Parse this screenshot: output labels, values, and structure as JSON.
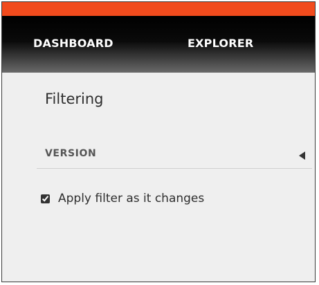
{
  "nav": {
    "items": [
      {
        "label": "DASHBOARD"
      },
      {
        "label": "EXPLORER"
      }
    ]
  },
  "panel": {
    "title": "Filtering",
    "section": {
      "label": "VERSION",
      "icon": "collapse-arrow-left-icon"
    },
    "option": {
      "label": "Apply filter as it changes",
      "checked": true
    }
  },
  "colors": {
    "accent": "#f24b1d",
    "nav_bg": "#000000",
    "panel_bg": "#efefef"
  }
}
